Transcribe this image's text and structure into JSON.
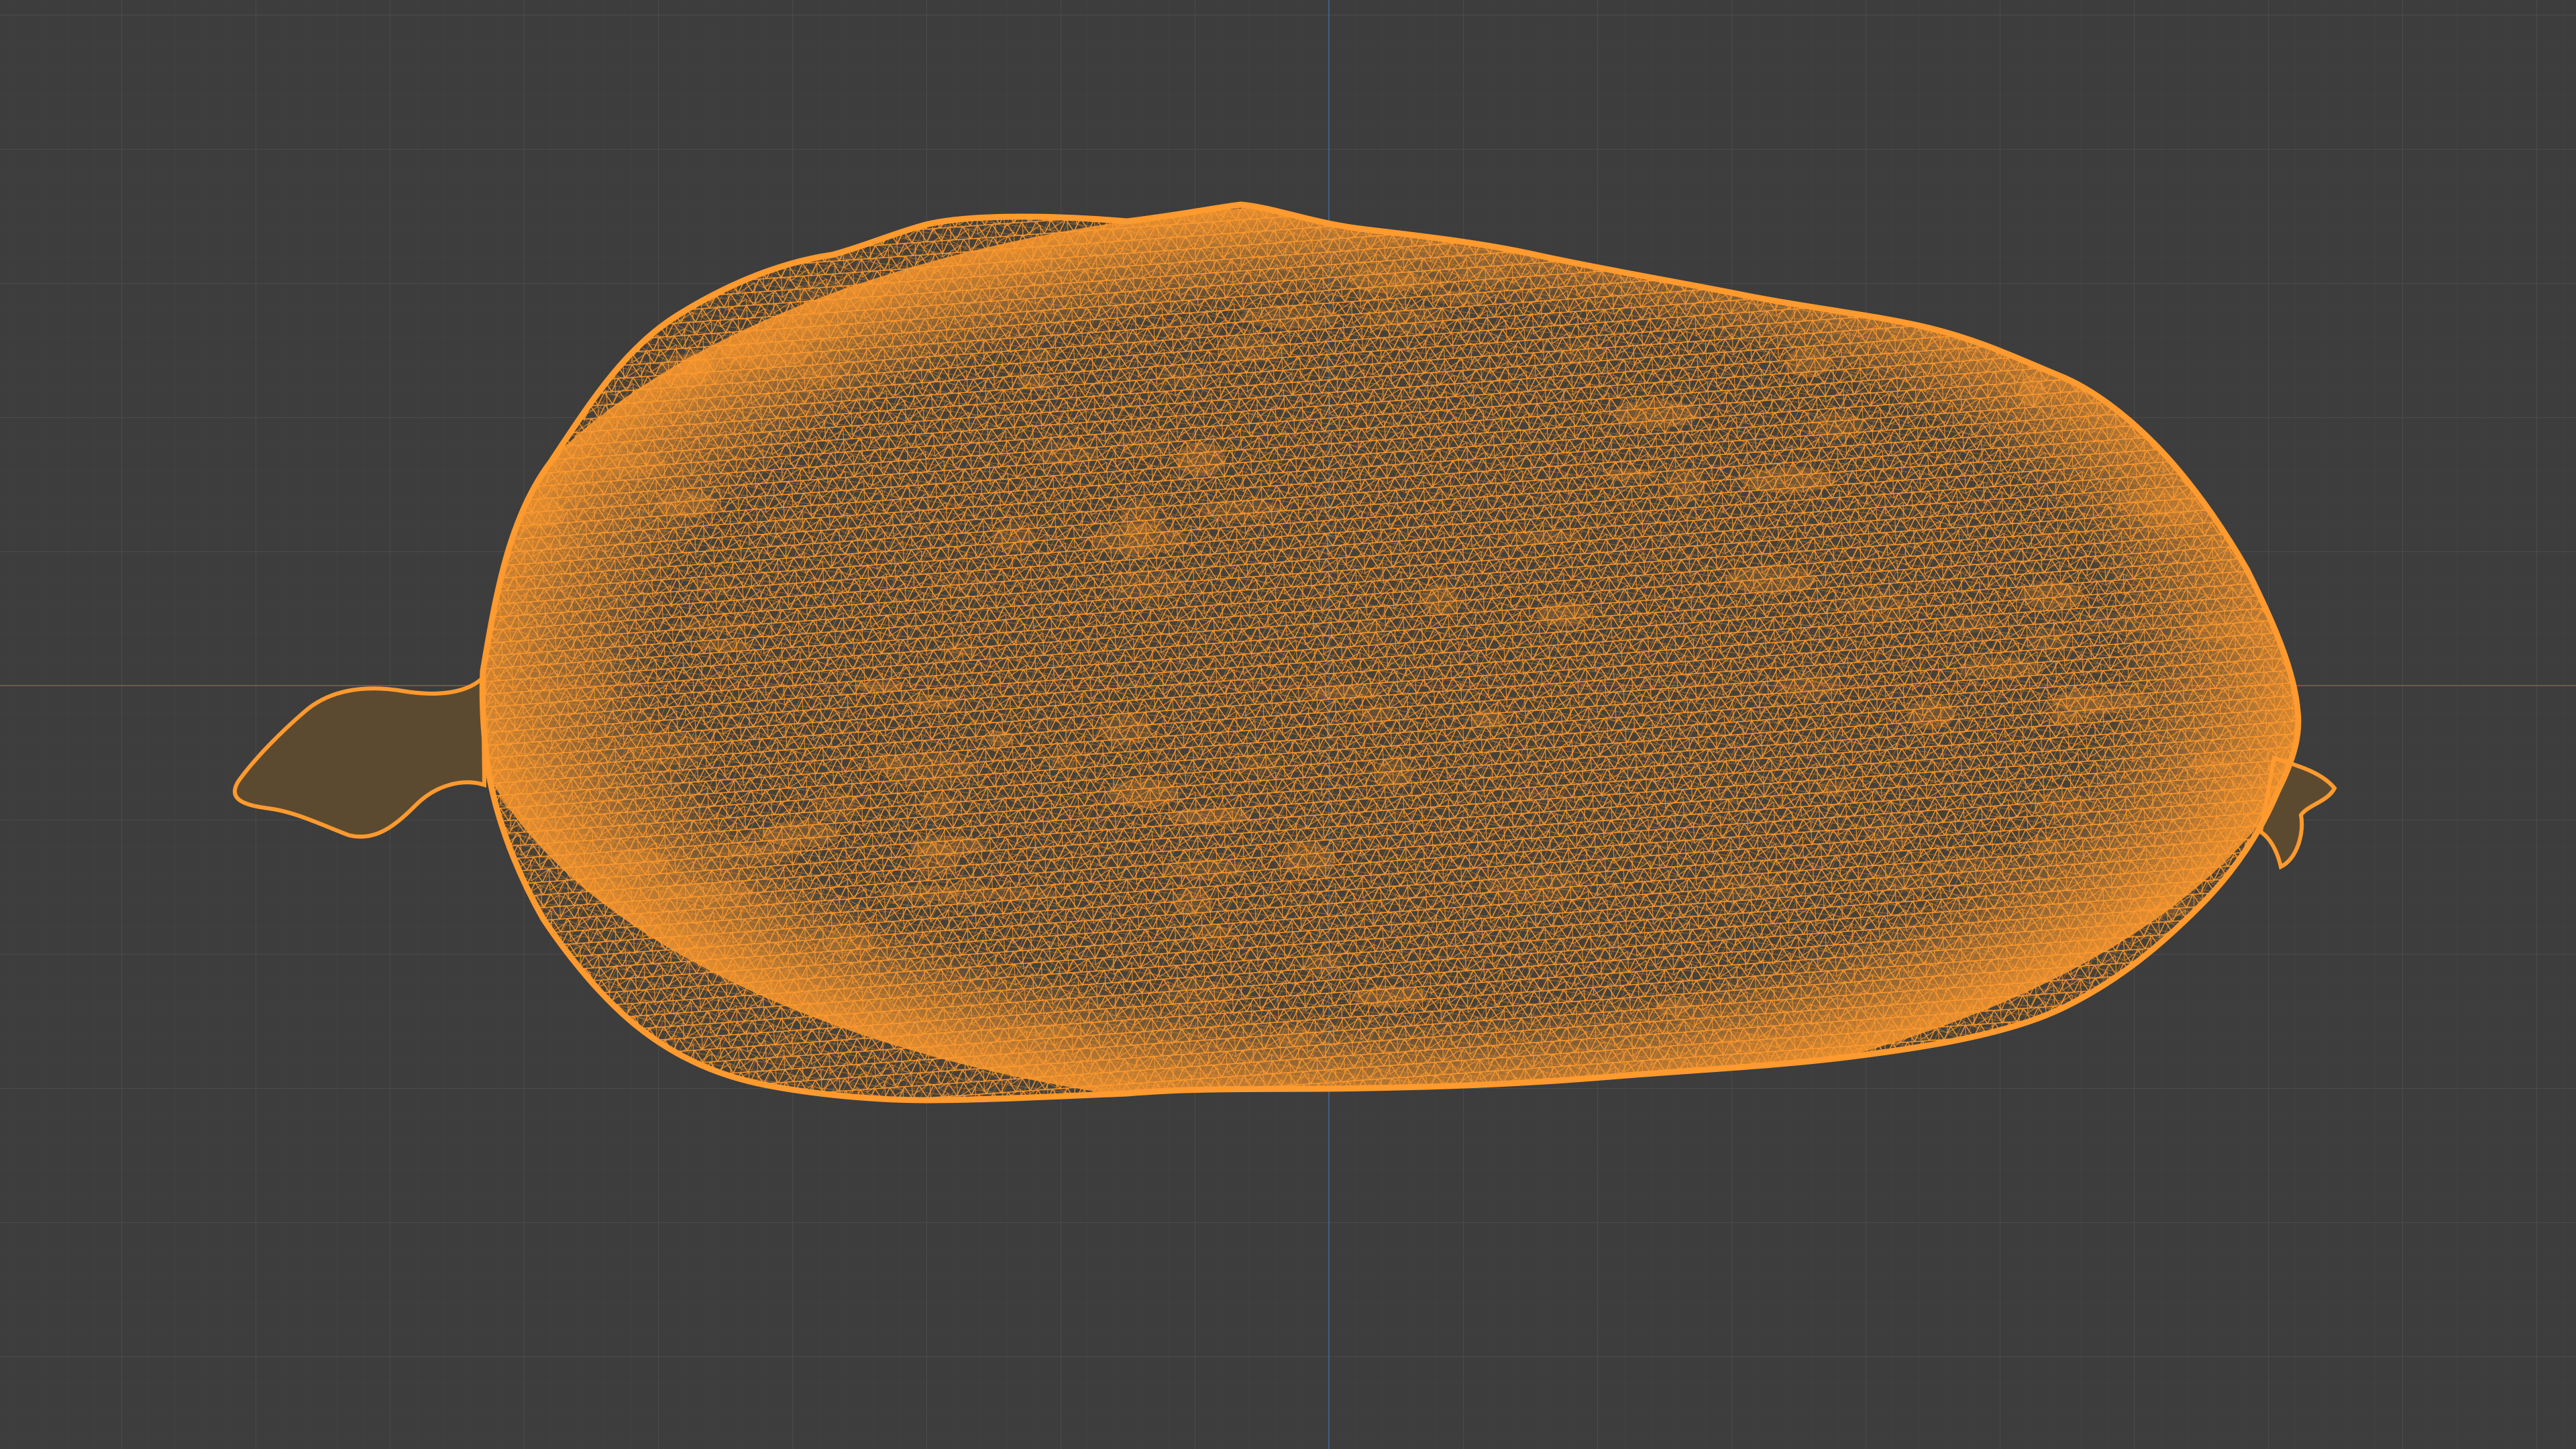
{
  "viewport": {
    "background_color": "#3d3d3d",
    "grid_minor_color": "#444444",
    "grid_major_color": "#4b4b4b",
    "x_axis_color": "#8a4b4b",
    "y_axis_color": "#3f5f86"
  },
  "object": {
    "icon": "cucumber-wireframe-icon",
    "display_mode": "wireframe",
    "selected": true,
    "wire_color": "#ff9a2e",
    "fill_color": "#5c4a30"
  }
}
